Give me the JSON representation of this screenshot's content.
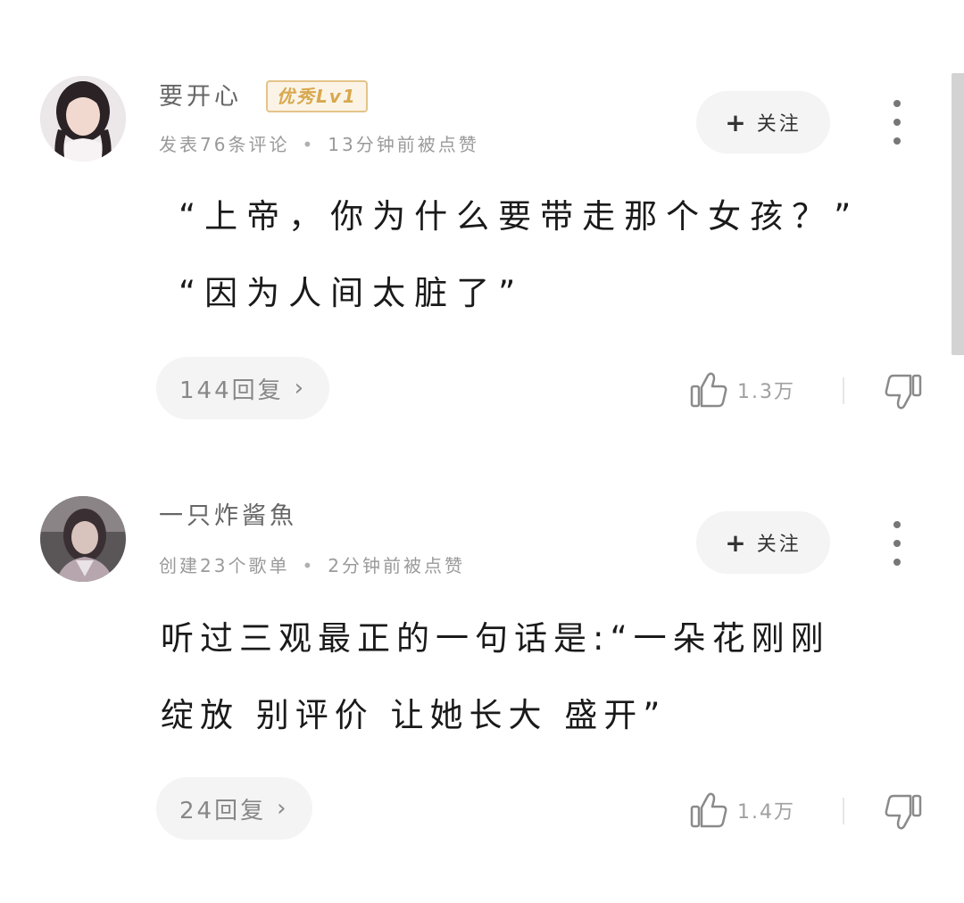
{
  "comments": [
    {
      "username": "要开心",
      "badge": "优秀Lv1",
      "meta_left": "发表76条评论",
      "meta_separator": "•",
      "meta_right": "13分钟前被点赞",
      "follow_plus": "+",
      "follow_label": "关注",
      "content_lines": [
        "“上帝，你为什么要带走那个女孩？”",
        "“因为人间太脏了”"
      ],
      "reply_label": "144回复",
      "reply_chevron": "›",
      "like_count": "1.3万"
    },
    {
      "username": "一只炸酱魚",
      "meta_left": "创建23个歌单",
      "meta_separator": "•",
      "meta_right": "2分钟前被点赞",
      "follow_plus": "+",
      "follow_label": "关注",
      "content_lines": [
        "听过三观最正的一句话是:“一朵花刚刚",
        "绽放 别评价 让她长大 盛开”"
      ],
      "reply_label": "24回复",
      "reply_chevron": "›",
      "like_count": "1.4万"
    }
  ],
  "icons": {
    "like": "thumbs-up-outline-icon",
    "dislike": "thumbs-down-outline-icon",
    "more": "more-vertical-icon"
  },
  "colors": {
    "badge_text": "#d8a84f",
    "badge_border": "#e4c48a",
    "button_bg": "#f4f4f4",
    "muted_text": "#9a9a9a"
  }
}
